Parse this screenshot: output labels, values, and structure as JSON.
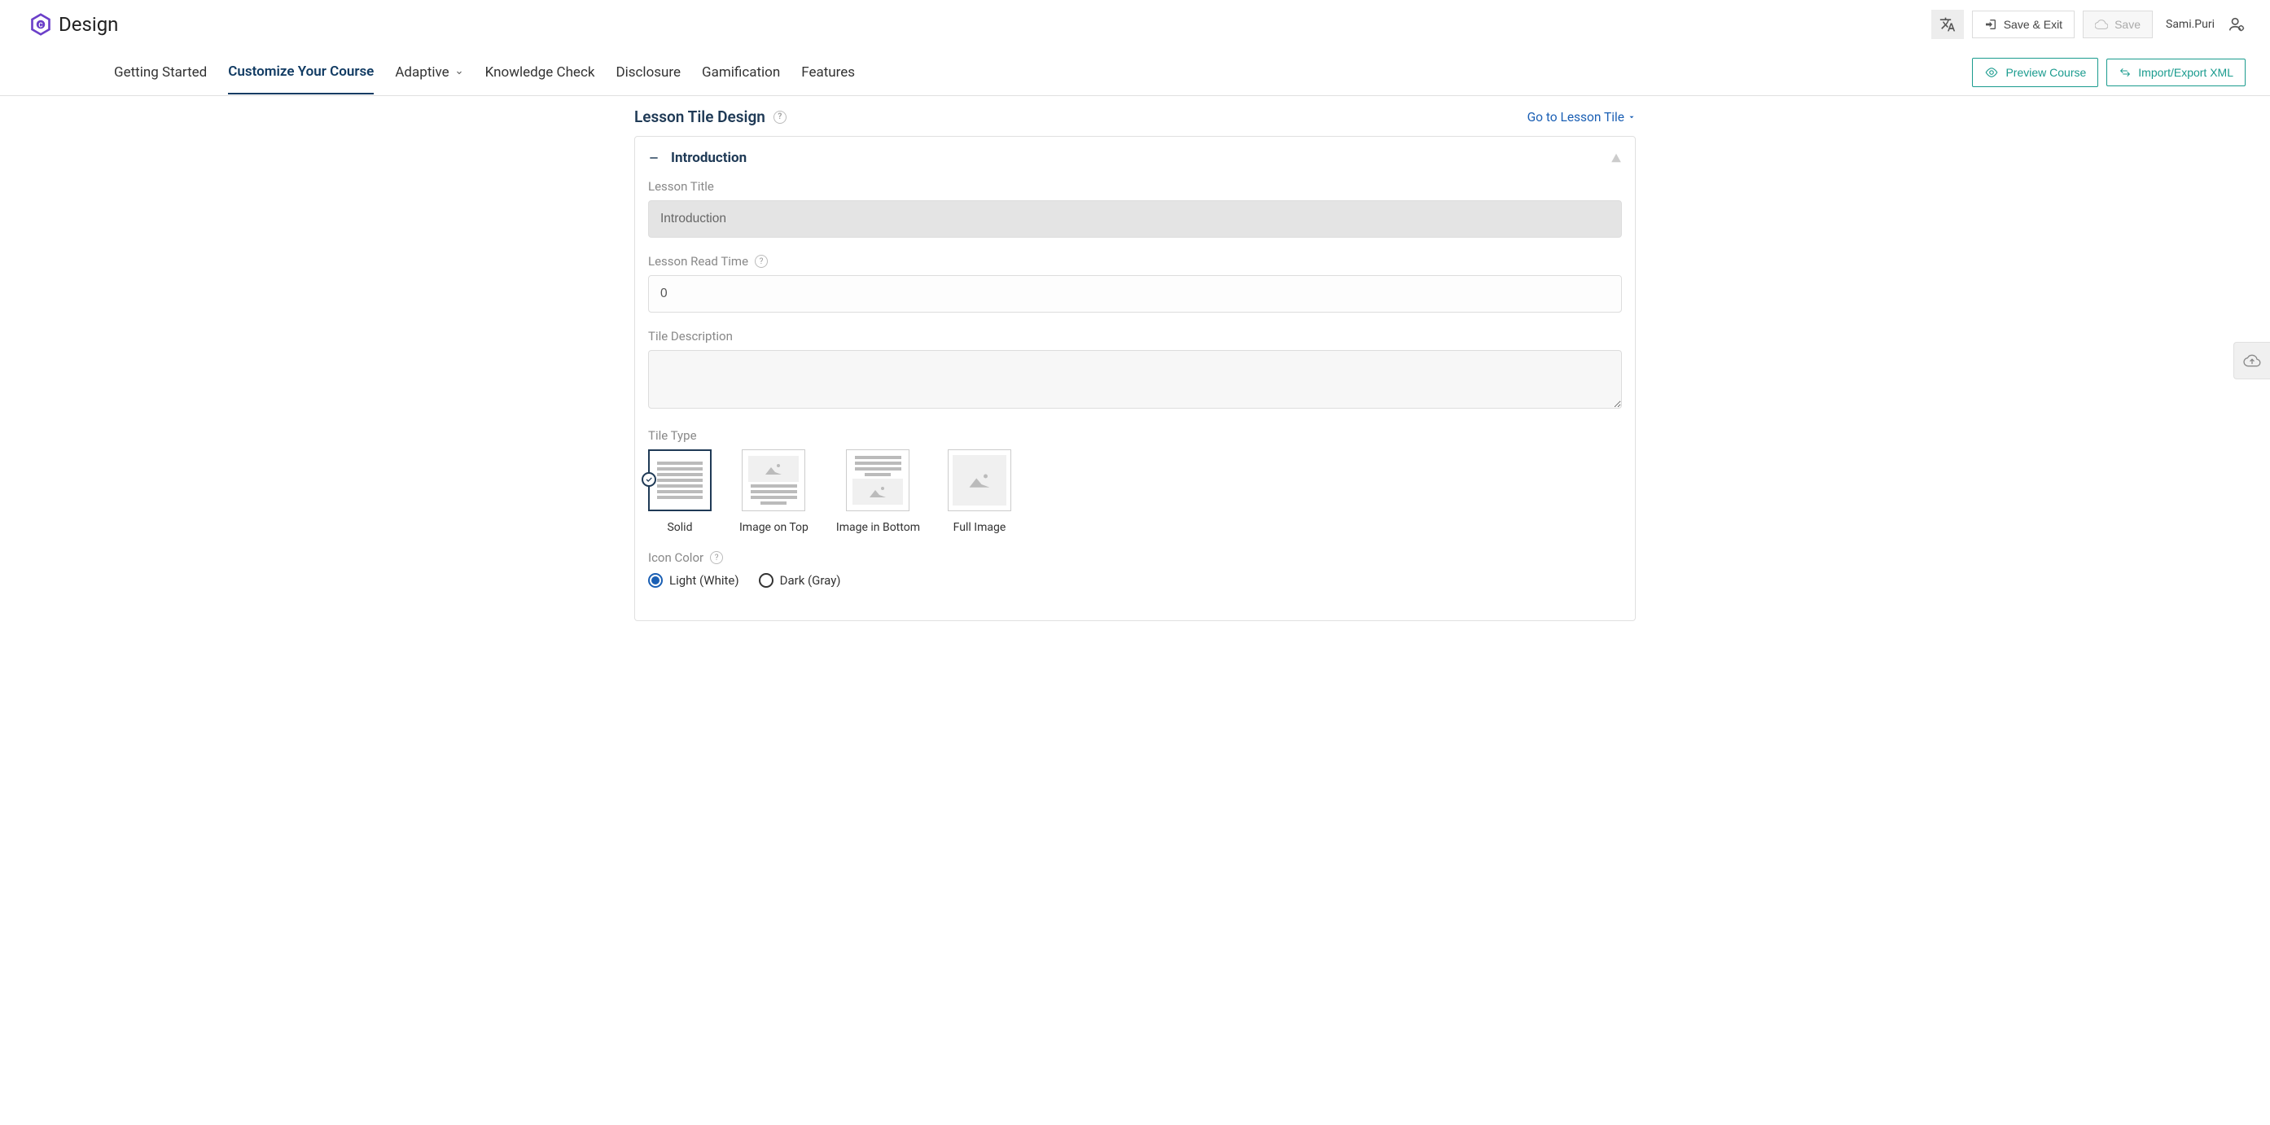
{
  "brand": {
    "text": "Design"
  },
  "header": {
    "save_exit": "Save & Exit",
    "save": "Save",
    "username": "Sami.Puri"
  },
  "nav": {
    "items": [
      {
        "label": "Getting Started"
      },
      {
        "label": "Customize Your Course"
      },
      {
        "label": "Adaptive"
      },
      {
        "label": "Knowledge Check"
      },
      {
        "label": "Disclosure"
      },
      {
        "label": "Gamification"
      },
      {
        "label": "Features"
      }
    ],
    "preview": "Preview Course",
    "import_export": "Import/Export XML"
  },
  "section": {
    "title": "Lesson Tile Design",
    "goto": "Go to Lesson Tile"
  },
  "panel": {
    "title": "Introduction",
    "fields": {
      "lesson_title": {
        "label": "Lesson Title",
        "value": "Introduction"
      },
      "read_time": {
        "label": "Lesson Read Time",
        "value": "0"
      },
      "description": {
        "label": "Tile Description",
        "value": ""
      },
      "tile_type": {
        "label": "Tile Type",
        "options": [
          "Solid",
          "Image on Top",
          "Image in Bottom",
          "Full Image"
        ]
      },
      "icon_color": {
        "label": "Icon Color",
        "options": [
          "Light (White)",
          "Dark (Gray)"
        ]
      }
    }
  }
}
